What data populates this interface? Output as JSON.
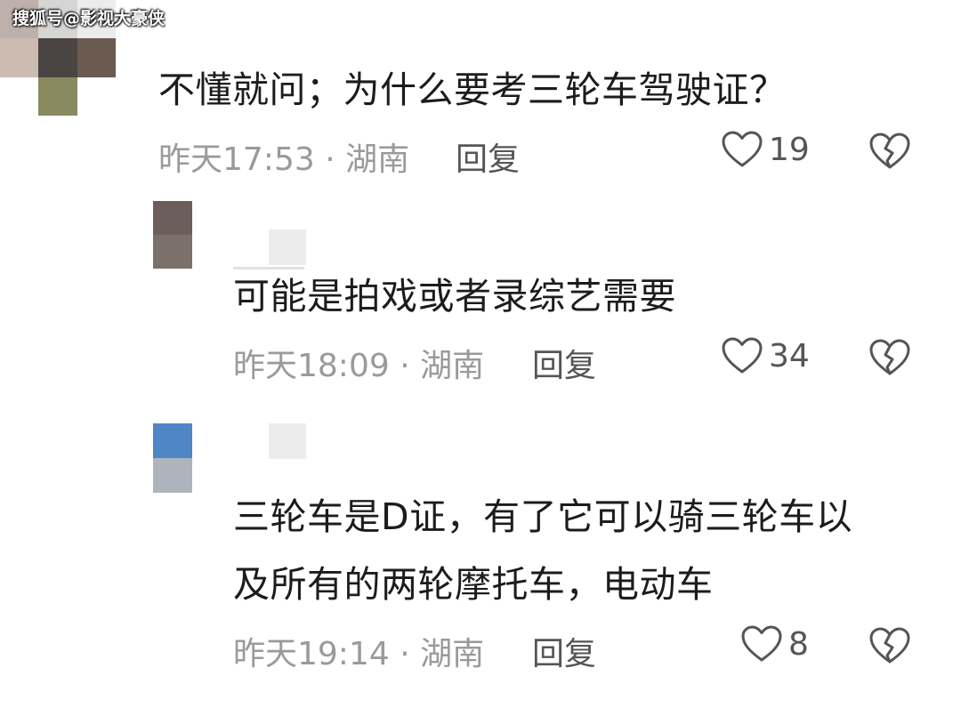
{
  "watermark": "搜狐号@影视大豪侠",
  "colors": {
    "text": "#1c1c1c",
    "meta": "#9a9a9a",
    "icon": "#555555"
  },
  "comments": [
    {
      "text": "不懂就问；为什么要考三轮车驾驶证？",
      "time": "昨天17:53 · 湖南",
      "reply": "回复",
      "likes": "19",
      "like_icon": "heart-outline-icon",
      "dislike_icon": "broken-heart-icon"
    },
    {
      "text": "可能是拍戏或者录综艺需要",
      "time": "昨天18:09 · 湖南",
      "reply": "回复",
      "likes": "34",
      "like_icon": "heart-outline-icon",
      "dislike_icon": "broken-heart-icon"
    },
    {
      "text_lines": [
        "三轮车是D证，有了它可以骑三轮车以",
        "及所有的两轮摩托车，电动车"
      ],
      "time": "昨天19:14 · 湖南",
      "reply": "回复",
      "likes": "8",
      "like_icon": "heart-outline-icon",
      "dislike_icon": "broken-heart-icon"
    }
  ]
}
